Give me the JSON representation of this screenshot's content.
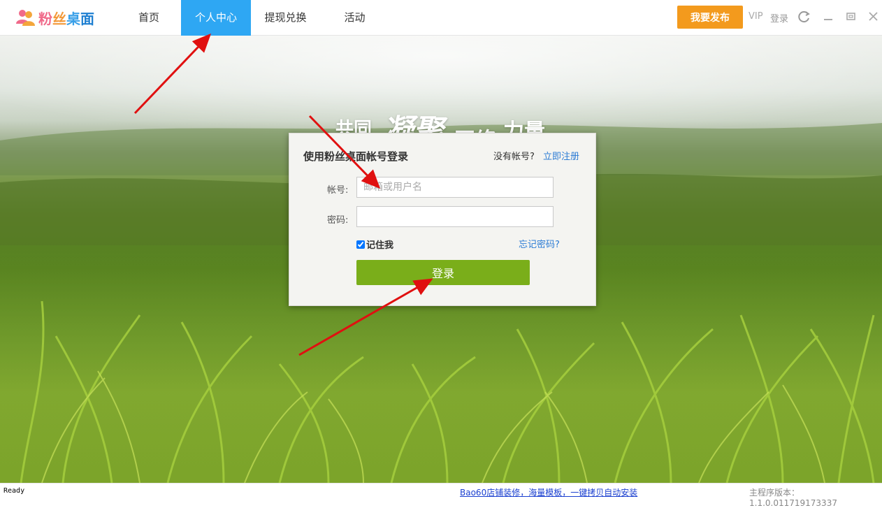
{
  "app": {
    "logo_text": "粉丝桌面"
  },
  "nav": {
    "items": [
      {
        "label": "首页",
        "active": false
      },
      {
        "label": "个人中心",
        "active": true
      },
      {
        "label": "提现兑换",
        "active": false
      },
      {
        "label": "活动",
        "active": false
      }
    ]
  },
  "header": {
    "publish_label": "我要发布",
    "vip_label": "VIP",
    "login_label": "登录",
    "icons": [
      "refresh-icon",
      "minimize-icon",
      "maximize-icon",
      "close-icon"
    ]
  },
  "slogan": {
    "part1": "共同",
    "part2": "凝聚",
    "part3": "网络",
    "part4": "力量"
  },
  "login": {
    "title": "使用粉丝桌面帐号登录",
    "no_account_text": "没有帐号?",
    "register_link": "立即注册",
    "account_label": "帐号:",
    "account_placeholder": "邮箱或用户名",
    "account_value": "",
    "password_label": "密码:",
    "password_value": "",
    "remember_label": "记住我",
    "remember_checked": true,
    "forgot_link": "忘记密码?",
    "submit_label": "登录"
  },
  "status": {
    "ready": "Ready",
    "promo_link": "Bao60店铺装修，海量模板，一键拷贝自动安装",
    "version": "主程序版本：1.1.0.011719173337"
  },
  "colors": {
    "nav_active": "#2ea7f3",
    "publish_button": "#f39a1d",
    "login_button": "#7aae1a",
    "link": "#2b7bd4",
    "annotation_arrow": "#e01010"
  }
}
